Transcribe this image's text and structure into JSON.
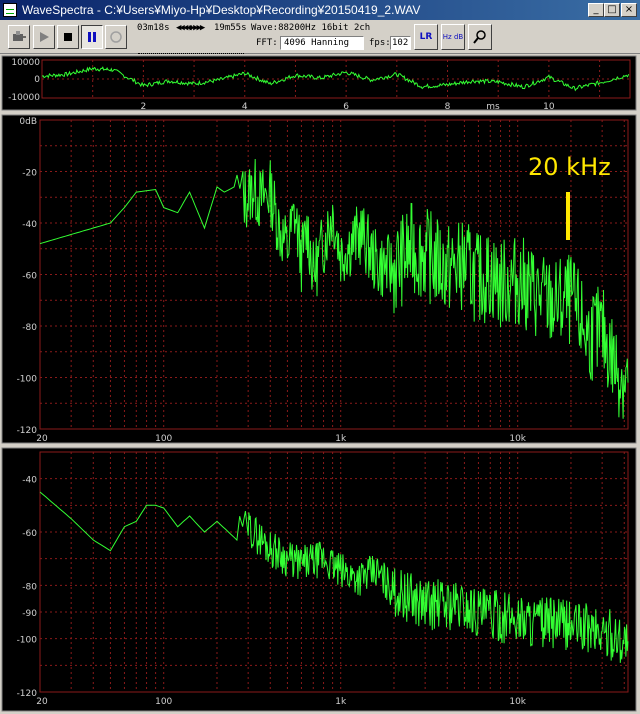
{
  "window": {
    "title": "WaveSpectra - C:¥Users¥Miyo-Hp¥Desktop¥Recording¥20150419_2.WAV",
    "min_glyph": "_",
    "max_glyph": "□",
    "close_glyph": "×"
  },
  "toolbar": {
    "position_time": "03m18s",
    "seek_buttons": "◀◀◀◀▶▶▶▶",
    "total_time": "19m55s",
    "wave_info": "Wave:88200Hz 16bit 2ch",
    "fft_label": "FFT:",
    "fft_value": "4096 Hanning",
    "fps_label": "fps:",
    "fps_value": "102",
    "lr_button_label": "LR",
    "hz_db_button_label": "Hz dB",
    "position_fraction": 0.04
  },
  "waveform": {
    "y_ticks": [
      "10000",
      "0",
      "-10000"
    ],
    "x_ticks": [
      "2",
      "4",
      "6",
      "8",
      "10"
    ],
    "x_unit": "ms"
  },
  "spectrum_top": {
    "y_ticks": [
      "0dB",
      "-20",
      "-40",
      "-60",
      "-80",
      "-100",
      "-120"
    ],
    "x_ticks": [
      "20",
      "100",
      "1k",
      "10k"
    ],
    "annotation": "20 kHz",
    "annotation_color": "#ffe800"
  },
  "spectrum_bottom": {
    "y_ticks": [
      "-40",
      "-60",
      "-80",
      "-90",
      "-100",
      "-120"
    ],
    "x_ticks": [
      "20",
      "100",
      "1k",
      "10k"
    ]
  },
  "colors": {
    "plot_bg": "#000000",
    "trace": "#33ff33",
    "grid": "#8a1a1a",
    "window_bg": "#d4d0c8",
    "title_bar": "#0a246a"
  },
  "chart_data": [
    {
      "type": "line",
      "title": "",
      "xlabel": "ms",
      "ylabel": "",
      "xlim": [
        0,
        11.6
      ],
      "ylim": [
        -10000,
        10000
      ],
      "series": [
        {
          "x": [
            0,
            0.5,
            1,
            1.4,
            2,
            2.5,
            3,
            3.5,
            4,
            4.5,
            5,
            5.5,
            6,
            6.5,
            7,
            7.5,
            8,
            8.5,
            9,
            9.5,
            10,
            10.5,
            11,
            11.6
          ],
          "values": [
            1500,
            2500,
            5500,
            4800,
            -3500,
            -1000,
            -2500,
            -500,
            3000,
            -2500,
            2000,
            500,
            3500,
            -500,
            2500,
            -4000,
            -3000,
            -1000,
            -1500,
            -4200,
            1000,
            -5000,
            -2000,
            2500
          ]
        }
      ]
    },
    {
      "type": "line",
      "title": "",
      "xlabel": "",
      "ylabel": "",
      "x_scale": "log",
      "xlim": [
        20,
        42000
      ],
      "ylim": [
        -120,
        0
      ],
      "series": [
        {
          "x": [
            20,
            50,
            60,
            70,
            90,
            100,
            120,
            140,
            170,
            200,
            220,
            250,
            280,
            300,
            320,
            350,
            400,
            450,
            500,
            550,
            600,
            650,
            700,
            800,
            900,
            1000,
            1300,
            1600,
            2000,
            2500,
            3000,
            4000,
            5000,
            6000,
            7000,
            8000,
            10000,
            13000,
            16000,
            20000,
            25000,
            30000,
            36000,
            42000
          ],
          "values": [
            -48,
            -40,
            -34,
            -28,
            -27,
            -34,
            -36,
            -28,
            -42,
            -26,
            -28,
            -26,
            -30,
            -30,
            -26,
            -31,
            -28,
            -42,
            -50,
            -36,
            -54,
            -42,
            -60,
            -48,
            -36,
            -52,
            -44,
            -56,
            -58,
            -50,
            -52,
            -58,
            -56,
            -62,
            -60,
            -64,
            -62,
            -68,
            -72,
            -70,
            -84,
            -82,
            -96,
            -102
          ]
        }
      ]
    },
    {
      "type": "line",
      "title": "",
      "xlabel": "",
      "ylabel": "",
      "x_scale": "log",
      "xlim": [
        20,
        42000
      ],
      "ylim": [
        -120,
        -30
      ],
      "series": [
        {
          "x": [
            20,
            30,
            40,
            50,
            60,
            70,
            80,
            90,
            100,
            120,
            140,
            170,
            200,
            250,
            300,
            400,
            500,
            600,
            800,
            1000,
            1300,
            1600,
            2000,
            2500,
            3000,
            4000,
            5000,
            6000,
            7000,
            8000,
            10000,
            13000,
            16000,
            20000,
            25000,
            30000,
            36000,
            42000
          ],
          "values": [
            -45,
            -55,
            -63,
            -67,
            -58,
            -56,
            -50,
            -50,
            -51,
            -58,
            -54,
            -60,
            -56,
            -62,
            -58,
            -66,
            -70,
            -72,
            -70,
            -75,
            -77,
            -75,
            -82,
            -85,
            -87,
            -87,
            -88,
            -90,
            -91,
            -92,
            -92,
            -94,
            -94,
            -95,
            -96,
            -98,
            -99,
            -101
          ]
        }
      ]
    }
  ]
}
